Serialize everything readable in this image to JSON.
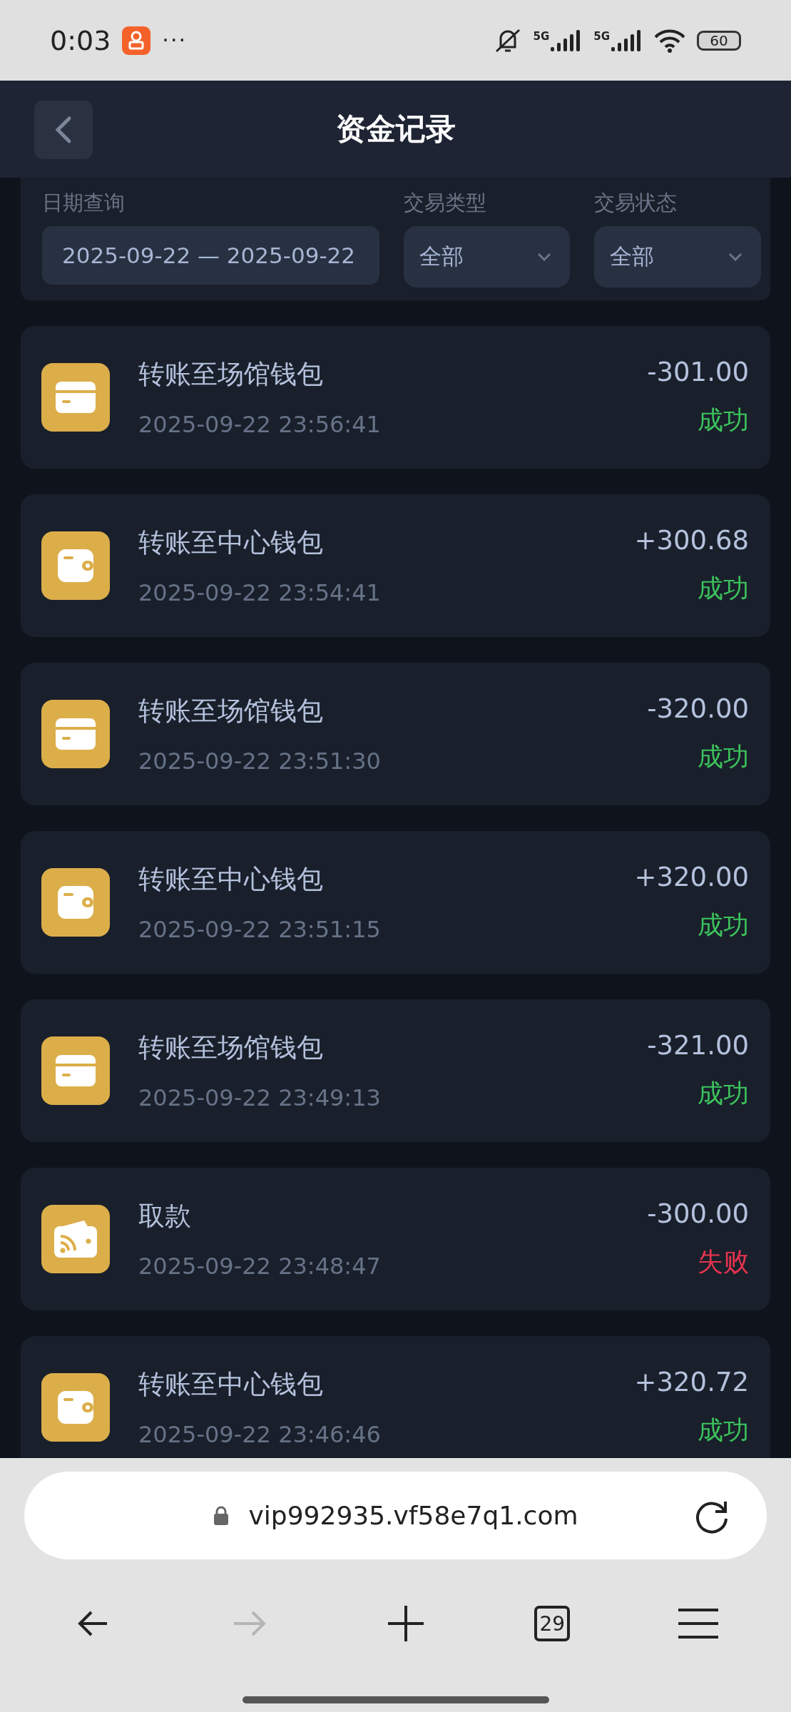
{
  "status_bar": {
    "time": "0:03",
    "more": "···",
    "signals": [
      {
        "label": "5G"
      },
      {
        "label": "5G"
      }
    ],
    "battery": "60"
  },
  "header": {
    "title": "资金记录"
  },
  "filters": [
    {
      "kind": "date",
      "label": "日期查询",
      "value": "2025-09-22 — 2025-09-22"
    },
    {
      "kind": "select",
      "label": "交易类型",
      "value": "全部"
    },
    {
      "kind": "select",
      "label": "交易状态",
      "value": "全部"
    }
  ],
  "records": [
    {
      "kind": "card",
      "title": "转账至场馆钱包",
      "time": "2025-09-22 23:56:41",
      "amount": "-301.00",
      "status": "成功",
      "success": true
    },
    {
      "kind": "wallet",
      "title": "转账至中心钱包",
      "time": "2025-09-22 23:54:41",
      "amount": "+300.68",
      "status": "成功",
      "success": true
    },
    {
      "kind": "card",
      "title": "转账至场馆钱包",
      "time": "2025-09-22 23:51:30",
      "amount": "-320.00",
      "status": "成功",
      "success": true
    },
    {
      "kind": "wallet",
      "title": "转账至中心钱包",
      "time": "2025-09-22 23:51:15",
      "amount": "+320.00",
      "status": "成功",
      "success": true
    },
    {
      "kind": "card",
      "title": "转账至场馆钱包",
      "time": "2025-09-22 23:49:13",
      "amount": "-321.00",
      "status": "成功",
      "success": true
    },
    {
      "kind": "withdraw",
      "title": "取款",
      "time": "2025-09-22 23:48:47",
      "amount": "-300.00",
      "status": "失败",
      "success": false
    },
    {
      "kind": "wallet",
      "title": "转账至中心钱包",
      "time": "2025-09-22 23:46:46",
      "amount": "+320.72",
      "status": "成功",
      "success": true
    }
  ],
  "browser": {
    "url": "vip992935.vf58e7q1.com",
    "forward_disabled": true,
    "tab_count": "29"
  }
}
